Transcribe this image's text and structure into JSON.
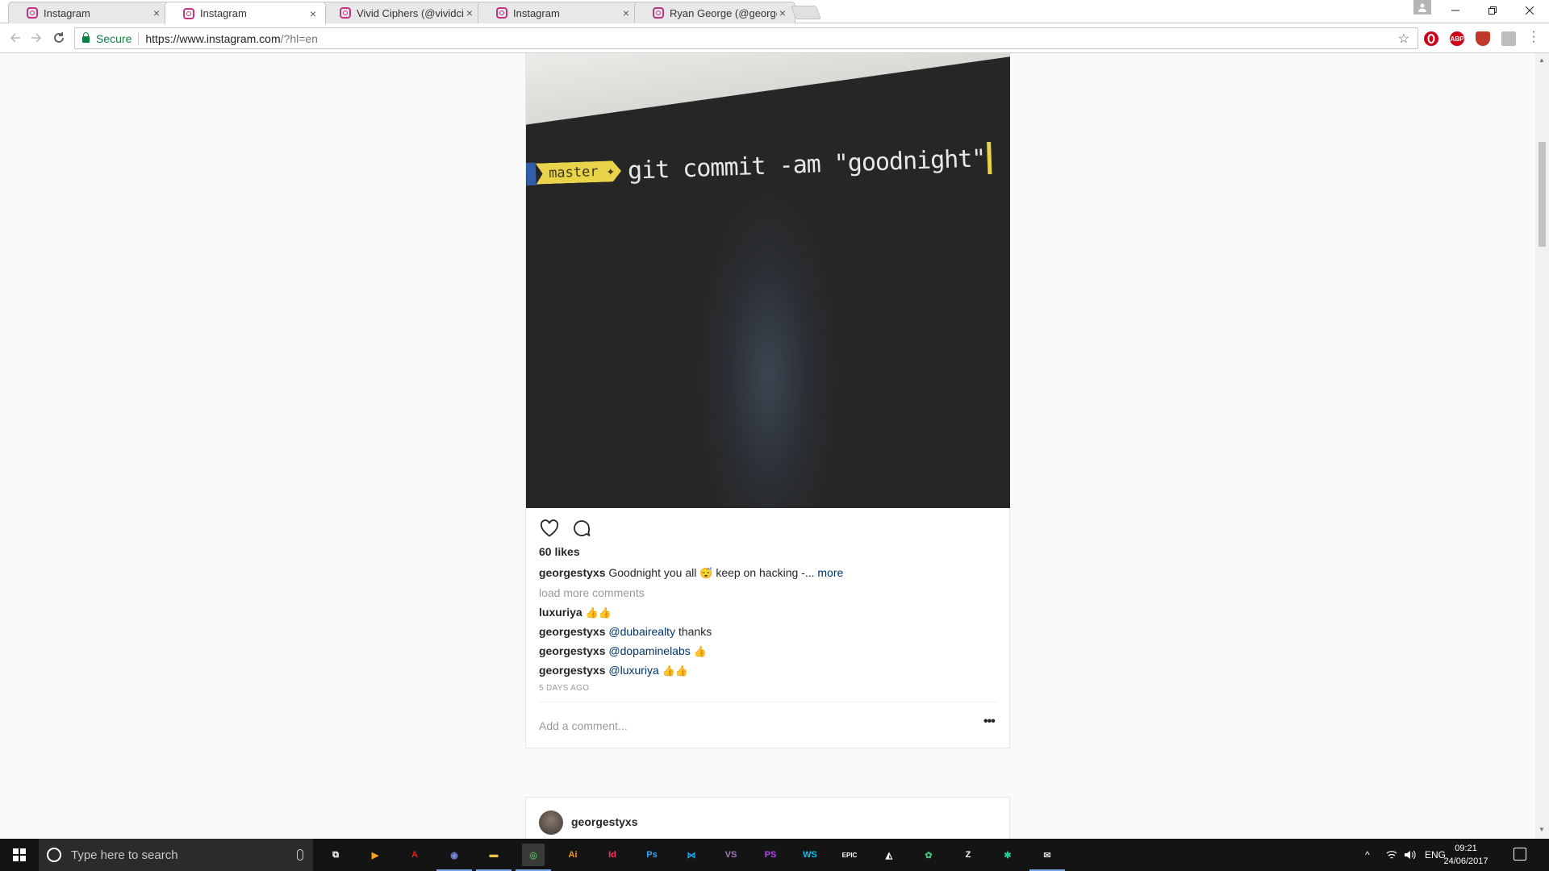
{
  "browser": {
    "tabs": [
      {
        "title": "Instagram",
        "active": false
      },
      {
        "title": "Instagram",
        "active": true
      },
      {
        "title": "Vivid Ciphers (@vividciph",
        "active": false
      },
      {
        "title": "Instagram",
        "active": false
      },
      {
        "title": "Ryan George (@georges",
        "active": false
      }
    ],
    "close_glyph": "×",
    "secure_label": "Secure",
    "url_host": "https://www.instagram.com",
    "url_path": "/?hl=en",
    "extensions": [
      {
        "name": "opera-icon",
        "color": "#d0021b",
        "label": "O"
      },
      {
        "name": "adblock-plus-icon",
        "color": "#d0021b",
        "label": "ABP"
      },
      {
        "name": "ublock-shield-icon",
        "color": "#c0392b",
        "label": "◆"
      },
      {
        "name": "pdf-extension-icon",
        "color": "#bdbdbd",
        "label": "⬚"
      }
    ]
  },
  "post": {
    "photo_text": {
      "branch": "master ✦",
      "command": "git commit -am \"goodnight\""
    },
    "likes": "60 likes",
    "caption": {
      "user": "georgestyxs",
      "text": "Goodnight you all",
      "emoji": "😴",
      "rest": "keep on hacking -...",
      "more": "more"
    },
    "load_more": "load more comments",
    "comments": [
      {
        "user": "luxuriya",
        "mention": "",
        "text": "",
        "emoji": "👍👍"
      },
      {
        "user": "georgestyxs",
        "mention": "@dubairealty",
        "text": "thanks",
        "emoji": ""
      },
      {
        "user": "georgestyxs",
        "mention": "@dopaminelabs",
        "text": "",
        "emoji": "👍"
      },
      {
        "user": "georgestyxs",
        "mention": "@luxuriya",
        "text": "",
        "emoji": "👍👍"
      }
    ],
    "timestamp": "5 DAYS AGO",
    "add_comment_placeholder": "Add a comment...",
    "options_glyph": "•••"
  },
  "next_post": {
    "user": "georgestyxs"
  },
  "taskbar": {
    "search_placeholder": "Type here to search",
    "apps": [
      {
        "name": "task-view-icon",
        "label": "⧉",
        "color": "#ffffff"
      },
      {
        "name": "media-player-icon",
        "label": "▶",
        "color": "#f7a21b"
      },
      {
        "name": "acrobat-icon",
        "label": "A",
        "color": "#e0241a"
      },
      {
        "name": "discord-icon",
        "label": "◉",
        "color": "#7289da"
      },
      {
        "name": "file-explorer-icon",
        "label": "▬",
        "color": "#f3c04c"
      },
      {
        "name": "chrome-icon",
        "label": "◎",
        "color": "#4caf50"
      },
      {
        "name": "illustrator-icon",
        "label": "Ai",
        "color": "#ff9a00"
      },
      {
        "name": "indesign-icon",
        "label": "Id",
        "color": "#ff3366"
      },
      {
        "name": "photoshop-icon",
        "label": "Ps",
        "color": "#31a8ff"
      },
      {
        "name": "vscode-icon",
        "label": "⋈",
        "color": "#23a9f2"
      },
      {
        "name": "visual-studio-icon",
        "label": "VS",
        "color": "#a074c4"
      },
      {
        "name": "phpstorm-icon",
        "label": "PS",
        "color": "#b345f1"
      },
      {
        "name": "webstorm-icon",
        "label": "WS",
        "color": "#07c3f2"
      },
      {
        "name": "epic-games-icon",
        "label": "EPIC",
        "color": "#ffffff"
      },
      {
        "name": "unity-icon",
        "label": "◭",
        "color": "#ffffff"
      },
      {
        "name": "gitkraken-icon",
        "label": "✿",
        "color": "#41c37f"
      },
      {
        "name": "zbrush-icon",
        "label": "Z",
        "color": "#ffffff"
      },
      {
        "name": "sourcetree-icon",
        "label": "✱",
        "color": "#1fcf8e"
      },
      {
        "name": "mail-icon",
        "label": "✉",
        "color": "#dddddd"
      }
    ],
    "tray_caret": "^",
    "language": "ENG",
    "time": "09:21",
    "date": "24/06/2017"
  }
}
